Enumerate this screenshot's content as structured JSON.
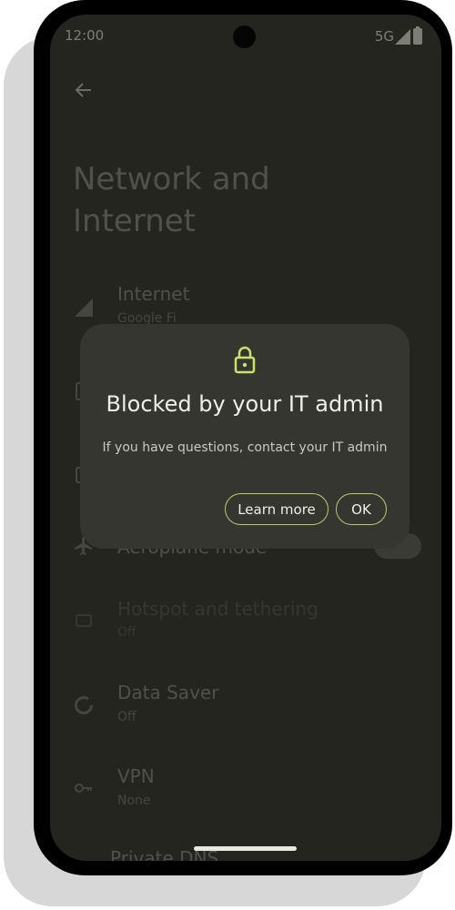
{
  "status_bar": {
    "time": "12:00",
    "network": "5G",
    "signal_icon": "signal-icon",
    "battery_icon": "battery-icon"
  },
  "header": {
    "back_icon": "arrow-left-icon",
    "title": "Network and Internet"
  },
  "settings_items": [
    {
      "label": "Internet",
      "subtitle": "Google Fi",
      "icon": "signal-icon"
    },
    {
      "label": "",
      "subtitle": "",
      "icon": "sim-icon"
    },
    {
      "label": "",
      "subtitle": "",
      "icon": "calls-sms-icon"
    },
    {
      "label": "Aeroplane mode",
      "subtitle": "",
      "icon": "airplane-icon",
      "toggle": false
    },
    {
      "label": "Hotspot and tethering",
      "subtitle": "Off",
      "icon": "hotspot-icon"
    },
    {
      "label": "Data Saver",
      "subtitle": "Off",
      "icon": "data-saver-icon"
    },
    {
      "label": "VPN",
      "subtitle": "None",
      "icon": "vpn-key-icon"
    },
    {
      "label": "Private DNS",
      "subtitle": "",
      "icon": ""
    }
  ],
  "dialog": {
    "icon": "lock-icon",
    "title": "Blocked by your IT admin",
    "message": "If you have questions, contact your IT admin",
    "learn_more_label": "Learn more",
    "ok_label": "OK"
  },
  "colors": {
    "accent": "#b9cc6e",
    "background": "#24251f",
    "dialog": "#35362f"
  }
}
